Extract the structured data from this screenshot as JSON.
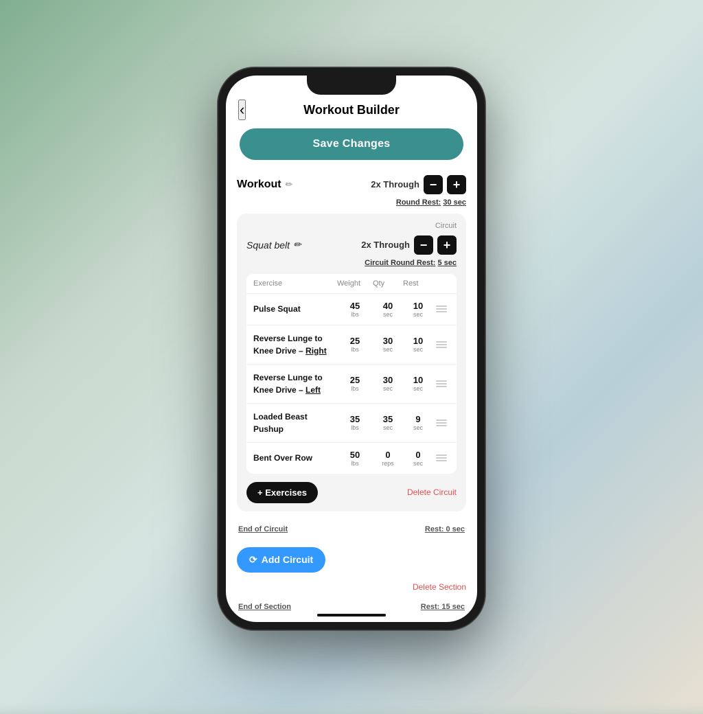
{
  "app": {
    "title": "Workout Builder",
    "back_label": "‹"
  },
  "save_button": {
    "label": "Save Changes"
  },
  "workout": {
    "label": "Workout",
    "edit_icon": "✏",
    "through_label": "2x Through",
    "round_rest_label": "Round Rest:",
    "round_rest_value": "30 sec"
  },
  "circuit": {
    "badge": "Circuit",
    "name": "Squat belt",
    "edit_icon": "✏",
    "through_label": "2x Through",
    "circuit_rest_label": "Circuit Round Rest:",
    "circuit_rest_value": "5 sec",
    "table_headers": {
      "exercise": "Exercise",
      "weight": "Weight",
      "qty": "Qty",
      "rest": "Rest"
    },
    "exercises": [
      {
        "name": "Pulse Squat",
        "name_underline": "",
        "weight_num": "45",
        "weight_unit": "lbs",
        "qty_num": "40",
        "qty_unit": "sec",
        "rest_num": "10",
        "rest_unit": "sec"
      },
      {
        "name": "Reverse Lunge to Knee Drive – ",
        "name_underline": "Right",
        "weight_num": "25",
        "weight_unit": "lbs",
        "qty_num": "30",
        "qty_unit": "sec",
        "rest_num": "10",
        "rest_unit": "sec"
      },
      {
        "name": "Reverse Lunge to Knee Drive – ",
        "name_underline": "Left",
        "weight_num": "25",
        "weight_unit": "lbs",
        "qty_num": "30",
        "qty_unit": "sec",
        "rest_num": "10",
        "rest_unit": "sec"
      },
      {
        "name": "Loaded Beast Pushup",
        "name_underline": "",
        "weight_num": "35",
        "weight_unit": "lbs",
        "qty_num": "35",
        "qty_unit": "sec",
        "rest_num": "9",
        "rest_unit": "sec"
      },
      {
        "name": "Bent Over Row",
        "name_underline": "",
        "weight_num": "50",
        "weight_unit": "lbs",
        "qty_num": "0",
        "qty_unit": "reps",
        "rest_num": "0",
        "rest_unit": "sec"
      }
    ],
    "add_exercises_label": "+ Exercises",
    "delete_circuit_label": "Delete Circuit",
    "end_circuit_label": "End of Circuit",
    "end_circuit_rest_label": "Rest:",
    "end_circuit_rest_value": "0 sec"
  },
  "add_circuit": {
    "label": "Add Circuit"
  },
  "delete_section": {
    "label": "Delete Section"
  },
  "end_section": {
    "label": "End of Section",
    "rest_label": "Rest:",
    "rest_value": "15 sec"
  }
}
